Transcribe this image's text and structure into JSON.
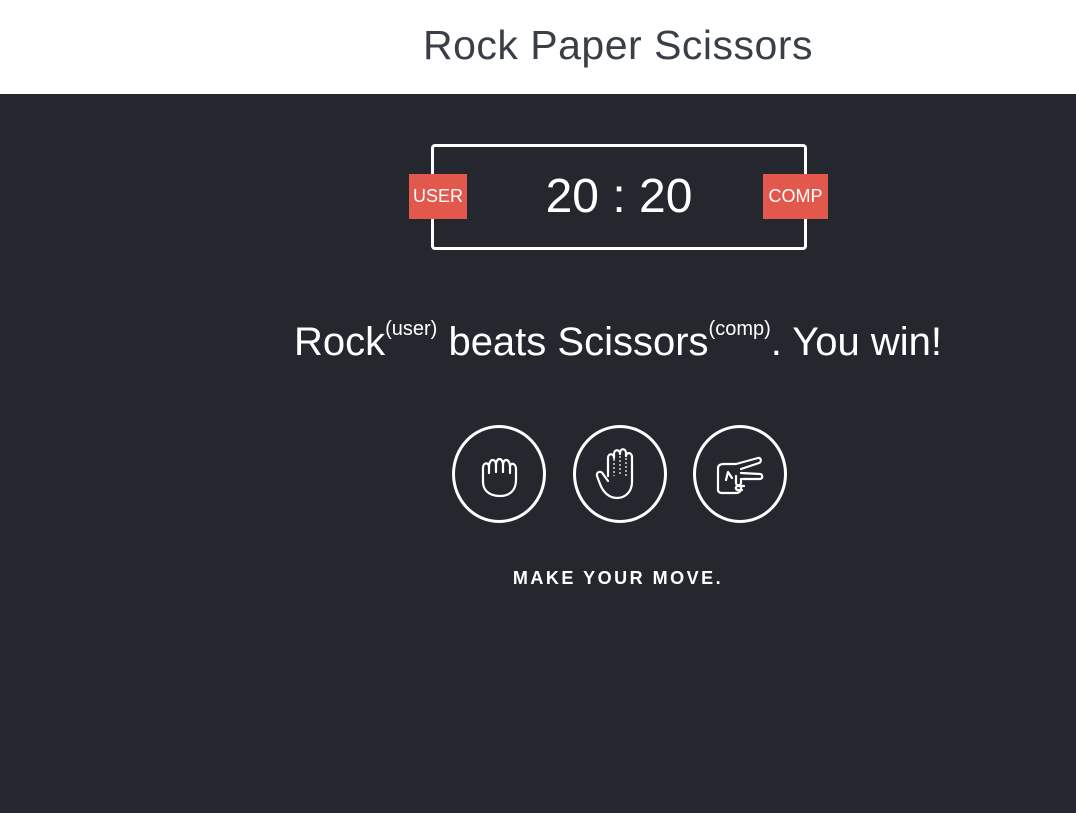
{
  "header": {
    "title": "Rock Paper Scissors"
  },
  "scoreboard": {
    "user_label": "USER",
    "comp_label": "COMP",
    "user_score": 20,
    "comp_score": 20,
    "separator": ":",
    "display": "20 : 20"
  },
  "result": {
    "user_move": "Rock",
    "user_tag": "(user)",
    "verb": " beats ",
    "comp_move": "Scissors",
    "comp_tag": "(comp)",
    "outcome": ". You win!"
  },
  "choices": [
    {
      "name": "rock",
      "icon": "rock-fist-icon"
    },
    {
      "name": "paper",
      "icon": "paper-hand-icon"
    },
    {
      "name": "scissors",
      "icon": "scissors-hand-icon"
    }
  ],
  "prompt": {
    "text": "MAKE YOUR MOVE."
  },
  "colors": {
    "background": "#24272e",
    "header_background": "#ffffff",
    "badge": "#e2584d",
    "text": "#ffffff",
    "title": "#3a3f47"
  }
}
